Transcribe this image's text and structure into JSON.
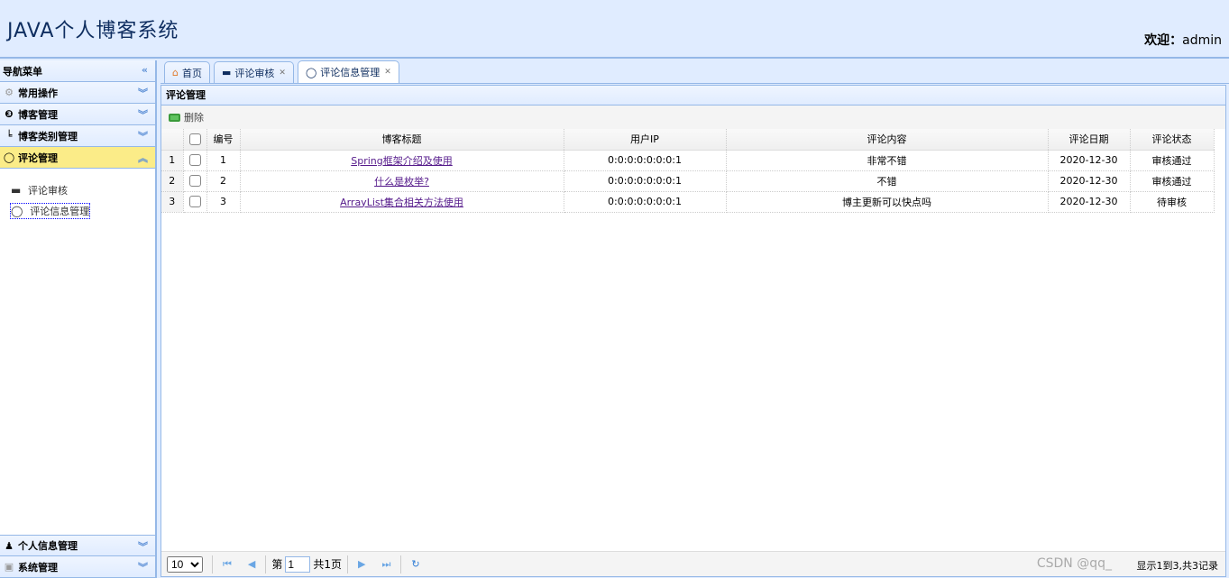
{
  "header": {
    "title": "JAVA个人博客系统",
    "welcome_label": "欢迎：",
    "user": "admin"
  },
  "nav": {
    "title": "导航菜单",
    "groups": [
      {
        "label": "常用操作",
        "icon": "gear-icon"
      },
      {
        "label": "博客管理",
        "icon": "blog-icon"
      },
      {
        "label": "博客类别管理",
        "icon": "tree-icon"
      },
      {
        "label": "评论管理",
        "icon": "comment-icon",
        "selected": true
      },
      {
        "label": "个人信息管理",
        "icon": "user-icon"
      },
      {
        "label": "系统管理",
        "icon": "system-icon"
      }
    ],
    "sub_items": [
      {
        "label": "评论审核",
        "icon": "review-icon"
      },
      {
        "label": "评论信息管理",
        "icon": "comment-icon"
      }
    ]
  },
  "tabs": [
    {
      "label": "首页"
    },
    {
      "label": "评论审核"
    },
    {
      "label": "评论信息管理"
    }
  ],
  "panel": {
    "title": "评论管理",
    "delete_label": "删除"
  },
  "grid": {
    "columns": [
      "编号",
      "博客标题",
      "用户IP",
      "评论内容",
      "评论日期",
      "评论状态"
    ],
    "rows": [
      {
        "rn": "1",
        "id": "1",
        "title": "Spring框架介绍及使用",
        "ip": "0:0:0:0:0:0:0:1",
        "content": "非常不错",
        "date": "2020-12-30",
        "status": "审核通过"
      },
      {
        "rn": "2",
        "id": "2",
        "title": "什么是枚举?",
        "ip": "0:0:0:0:0:0:0:1",
        "content": "不错",
        "date": "2020-12-30",
        "status": "审核通过"
      },
      {
        "rn": "3",
        "id": "3",
        "title": "ArrayList集合相关方法使用",
        "ip": "0:0:0:0:0:0:0:1",
        "content": "博主更新可以快点吗",
        "date": "2020-12-30",
        "status": "待审核"
      }
    ]
  },
  "pager": {
    "page_size": "10",
    "page_prefix": "第",
    "page": "1",
    "page_total": "共1页",
    "info": "显示1到3,共3记录"
  },
  "watermark": "CSDN @qq_"
}
